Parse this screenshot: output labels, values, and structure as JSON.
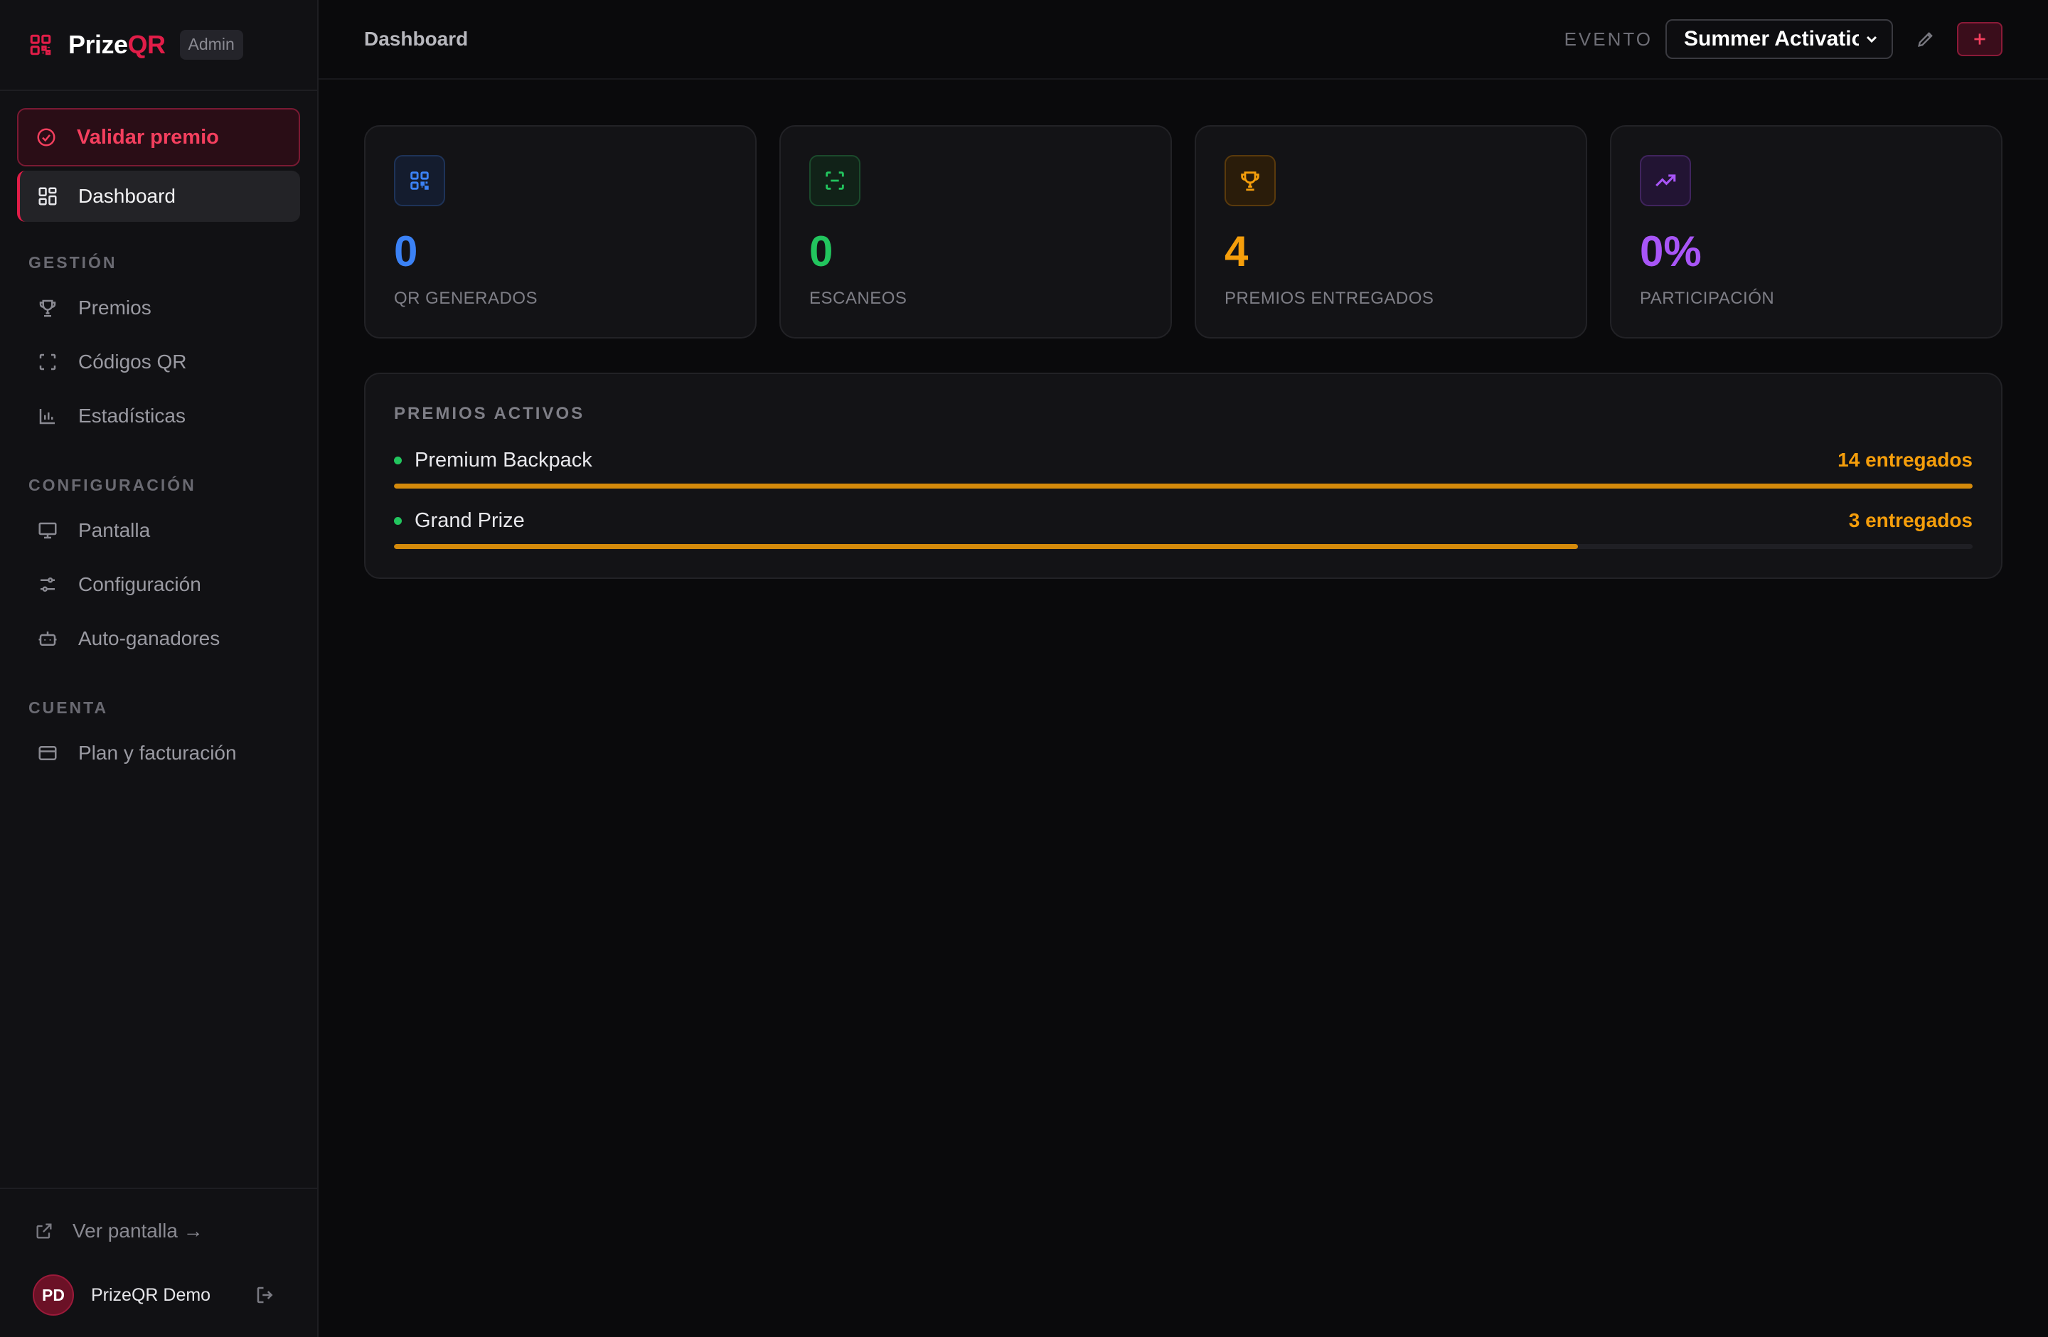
{
  "brand": {
    "name_main": "Prize",
    "name_accent": "QR",
    "badge": "Admin"
  },
  "sidebar": {
    "validate_label": "Validar premio",
    "dashboard_label": "Dashboard",
    "sections": [
      {
        "title": "GESTIÓN",
        "items": [
          "Premios",
          "Códigos QR",
          "Estadísticas"
        ]
      },
      {
        "title": "CONFIGURACIÓN",
        "items": [
          "Pantalla",
          "Configuración",
          "Auto-ganadores"
        ]
      },
      {
        "title": "CUENTA",
        "items": [
          "Plan y facturación"
        ]
      }
    ],
    "footer": {
      "view_screen": "Ver pantalla →",
      "avatar_initials": "PD",
      "user_name": "PrizeQR Demo"
    }
  },
  "header": {
    "title": "Dashboard",
    "event_label": "EVENTO",
    "event_value": "Summer Activation"
  },
  "stats": [
    {
      "value": "0",
      "label": "QR GENERADOS",
      "color": "#3b82f6",
      "icon": "qr-code-icon"
    },
    {
      "value": "0",
      "label": "ESCANEOS",
      "color": "#22c55e",
      "icon": "scan-icon"
    },
    {
      "value": "4",
      "label": "PREMIOS ENTREGADOS",
      "color": "#f59e0b",
      "icon": "trophy-icon"
    },
    {
      "value": "0%",
      "label": "PARTICIPACIÓN",
      "color": "#a855f7",
      "icon": "trending-up-icon"
    }
  ],
  "prizes": {
    "title": "PREMIOS ACTIVOS",
    "items": [
      {
        "name": "Premium Backpack",
        "count": "14 entregados",
        "progress": 1.0
      },
      {
        "name": "Grand Prize",
        "count": "3 entregados",
        "progress": 0.75
      }
    ]
  },
  "colors": {
    "accent": "#e11d48",
    "prize_bar": "#d48a0b",
    "active_dot": "#22c55e"
  }
}
